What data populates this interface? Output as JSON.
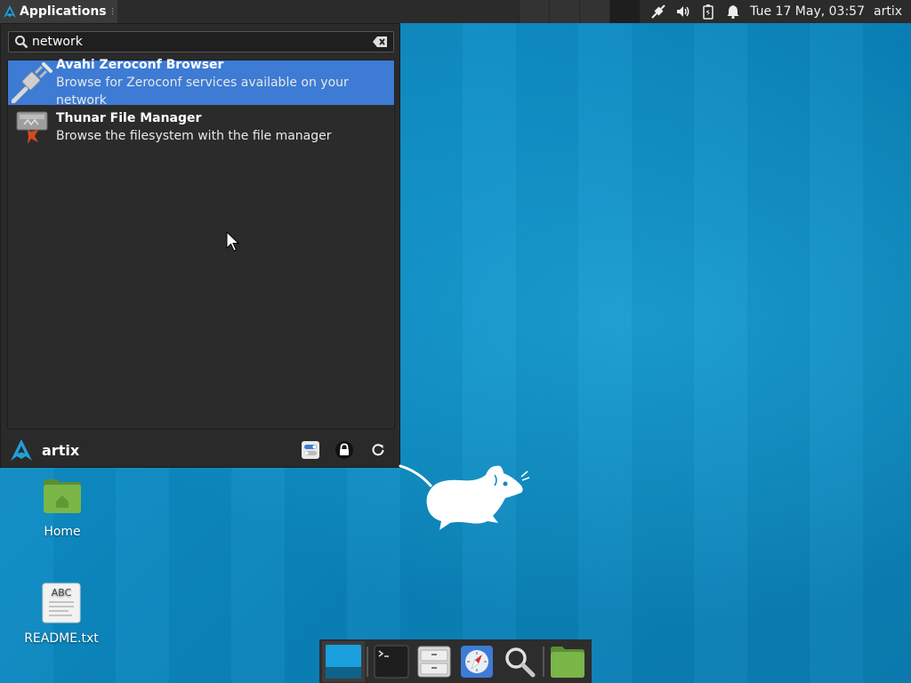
{
  "top_panel": {
    "applications_label": "Applications",
    "clock": "Tue 17 May, 03:57",
    "user": "artix",
    "tray_icons": [
      "network-wired-icon",
      "volume-icon",
      "battery-icon",
      "notification-bell-icon"
    ]
  },
  "menu": {
    "search_value": "network",
    "results": [
      {
        "title": "Avahi Zeroconf Browser",
        "description": "Browse for Zeroconf services available on your network",
        "icon": "network-plug-icon",
        "selected": true
      },
      {
        "title": "Thunar File Manager",
        "description": "Browse the filesystem with the file manager",
        "icon": "file-manager-icon",
        "selected": false
      }
    ],
    "footer": {
      "username": "artix",
      "buttons": [
        "settings-toggle-icon",
        "lock-icon",
        "restart-icon"
      ]
    }
  },
  "desktop": {
    "icons": [
      {
        "label": "Home",
        "icon": "home-folder-icon"
      },
      {
        "label": "README.txt",
        "icon": "text-file-icon",
        "file_text": "ABC"
      }
    ]
  },
  "dock": {
    "items": [
      "show-desktop-icon",
      "terminal-icon",
      "file-manager-icon",
      "web-browser-icon",
      "search-icon",
      "folder-icon"
    ]
  },
  "colors": {
    "panel": "#2b2b2b",
    "menu_bg": "#2a2a2a",
    "selection": "#3d7bd4",
    "desktop": "#0d8bc4"
  }
}
